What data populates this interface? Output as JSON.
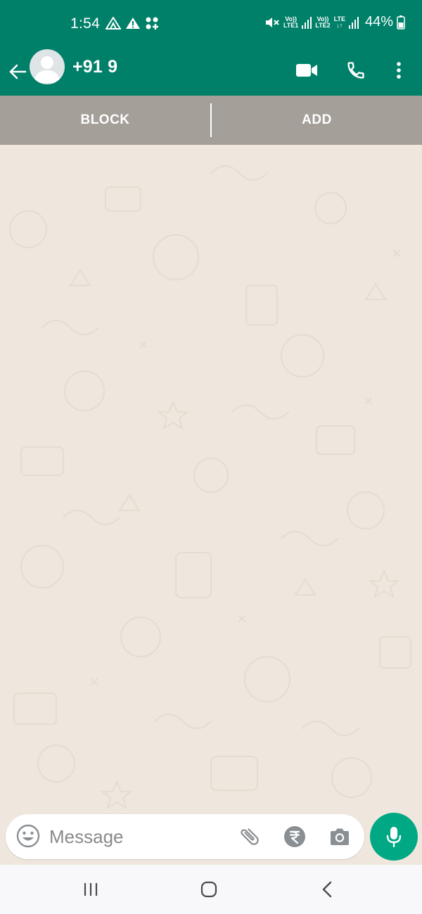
{
  "colors": {
    "primary": "#008069",
    "accent": "#00a884",
    "chat_bg": "#efe7de",
    "action_bar": "#a59f9a"
  },
  "status_bar": {
    "time": "1:54",
    "sim1_tag_top": "Vo))",
    "sim1_tag_bottom": "LTE1",
    "sim2_tag_top": "Vo))",
    "sim2_tag_bottom": "LTE2",
    "data_tag": "LTE",
    "battery": "44%",
    "icons": [
      "signal-a-icon",
      "warning-icon",
      "apps-icon",
      "mute-icon",
      "signal-icon",
      "battery-icon"
    ]
  },
  "header": {
    "contact_name": "+91 9",
    "icons": [
      "back-arrow-icon",
      "avatar-icon",
      "video-call-icon",
      "voice-call-icon",
      "more-options-icon"
    ]
  },
  "actions": {
    "block_label": "BLOCK",
    "add_label": "ADD"
  },
  "composer": {
    "placeholder": "Message",
    "value": "",
    "icons": [
      "emoji-icon",
      "attach-icon",
      "rupee-payment-icon",
      "camera-icon",
      "mic-icon"
    ]
  },
  "nav": {
    "icons": [
      "recent-apps-icon",
      "home-icon",
      "back-icon"
    ]
  }
}
